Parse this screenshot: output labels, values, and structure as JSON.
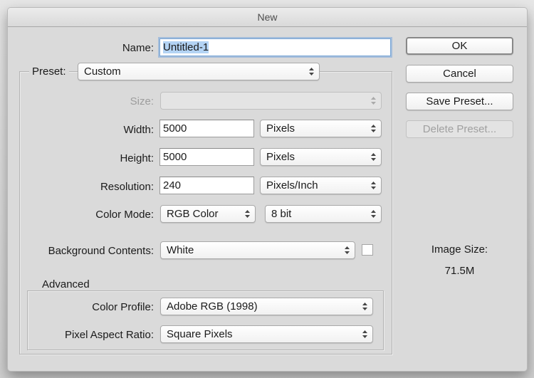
{
  "dialog": {
    "title": "New"
  },
  "name": {
    "label": "Name:",
    "value": "Untitled-1"
  },
  "preset": {
    "label": "Preset:",
    "value": "Custom"
  },
  "size": {
    "label": "Size:",
    "value": ""
  },
  "width": {
    "label": "Width:",
    "value": "5000",
    "unit": "Pixels"
  },
  "height": {
    "label": "Height:",
    "value": "5000",
    "unit": "Pixels"
  },
  "resolution": {
    "label": "Resolution:",
    "value": "240",
    "unit": "Pixels/Inch"
  },
  "color_mode": {
    "label": "Color Mode:",
    "mode": "RGB Color",
    "depth": "8 bit"
  },
  "background_contents": {
    "label": "Background Contents:",
    "value": "White",
    "swatch_color": "#ffffff"
  },
  "advanced": {
    "legend": "Advanced",
    "color_profile": {
      "label": "Color Profile:",
      "value": "Adobe RGB (1998)"
    },
    "pixel_aspect_ratio": {
      "label": "Pixel Aspect Ratio:",
      "value": "Square Pixels"
    }
  },
  "buttons": {
    "ok": "OK",
    "cancel": "Cancel",
    "save_preset": "Save Preset...",
    "delete_preset": "Delete Preset..."
  },
  "image_size": {
    "label": "Image Size:",
    "value": "71.5M"
  },
  "icons": {
    "stepper": "up-down-chevrons-icon"
  }
}
